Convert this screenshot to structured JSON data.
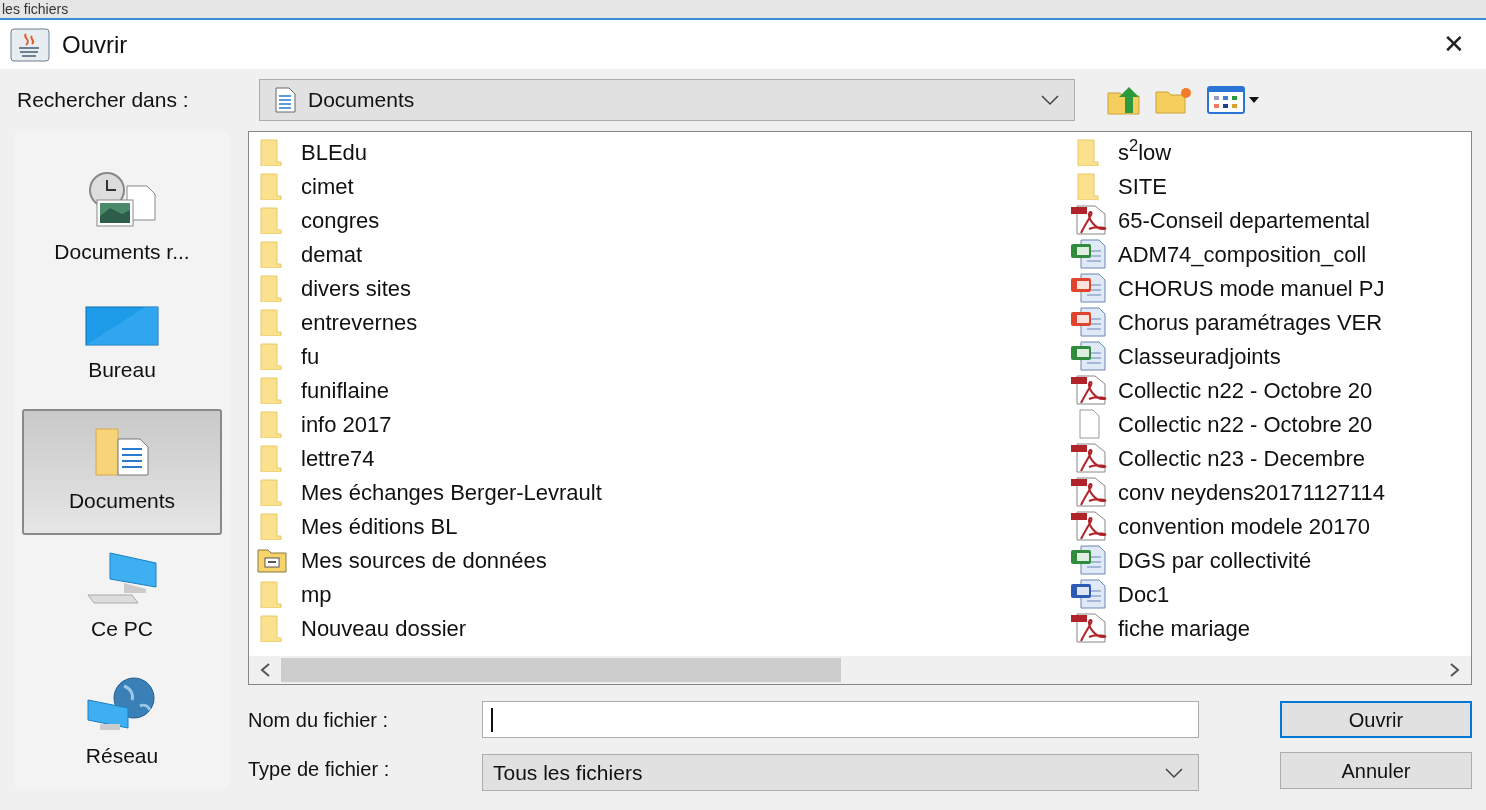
{
  "background_window": {
    "text": "les fichiers"
  },
  "window": {
    "title": "Ouvrir",
    "close": "✕"
  },
  "look_in": {
    "label": "Rechercher dans :",
    "value": "Documents"
  },
  "places": [
    {
      "label": "Documents r...",
      "kind": "recent",
      "selected": false
    },
    {
      "label": "Bureau",
      "kind": "desktop",
      "selected": false
    },
    {
      "label": "Documents",
      "kind": "documents",
      "selected": true
    },
    {
      "label": "Ce PC",
      "kind": "computer",
      "selected": false
    },
    {
      "label": "Réseau",
      "kind": "network",
      "selected": false
    }
  ],
  "files": [
    {
      "name": "BLEdu",
      "kind": "folder"
    },
    {
      "name": "cimet",
      "kind": "folder"
    },
    {
      "name": "congres",
      "kind": "folder"
    },
    {
      "name": "demat",
      "kind": "folder"
    },
    {
      "name": "divers sites",
      "kind": "folder"
    },
    {
      "name": "entrevernes",
      "kind": "folder"
    },
    {
      "name": "fu",
      "kind": "folder"
    },
    {
      "name": "funiflaine",
      "kind": "folder"
    },
    {
      "name": "info 2017",
      "kind": "folder"
    },
    {
      "name": "lettre74",
      "kind": "folder"
    },
    {
      "name": "Mes échanges Berger-Levrault",
      "kind": "folder"
    },
    {
      "name": "Mes éditions BL",
      "kind": "folder"
    },
    {
      "name": "Mes sources de données",
      "kind": "datasource"
    },
    {
      "name": "mp",
      "kind": "folder"
    },
    {
      "name": "Nouveau dossier",
      "kind": "folder"
    },
    {
      "name": "s$^{2}$low",
      "kind": "folder"
    },
    {
      "name": "SITE",
      "kind": "folder"
    },
    {
      "name": "65-Conseil departemental",
      "kind": "pdf"
    },
    {
      "name": "ADM74_composition_coll",
      "kind": "excel"
    },
    {
      "name": "CHORUS mode manuel PJ",
      "kind": "powerpoint"
    },
    {
      "name": "Chorus paramétrages VER",
      "kind": "powerpoint"
    },
    {
      "name": "Classeuradjoints",
      "kind": "excel"
    },
    {
      "name": "Collectic n22 - Octobre 20",
      "kind": "pdf"
    },
    {
      "name": "Collectic n22 - Octobre 20",
      "kind": "blank"
    },
    {
      "name": "Collectic n23 - Decembre",
      "kind": "pdf"
    },
    {
      "name": "conv neydens20171127114",
      "kind": "pdf"
    },
    {
      "name": "convention modele 20170",
      "kind": "pdf"
    },
    {
      "name": "DGS par collectivité",
      "kind": "excel"
    },
    {
      "name": "Doc1",
      "kind": "word"
    },
    {
      "name": "fiche mariage",
      "kind": "pdf"
    }
  ],
  "file_name": {
    "label": "Nom du fichier :"
  },
  "file_type": {
    "label": "Type de fichier :",
    "value": "Tous les fichiers"
  },
  "buttons": [
    {
      "label": "Ouvrir",
      "kind": "default"
    },
    {
      "label": "Annuler",
      "kind": "normal"
    }
  ]
}
